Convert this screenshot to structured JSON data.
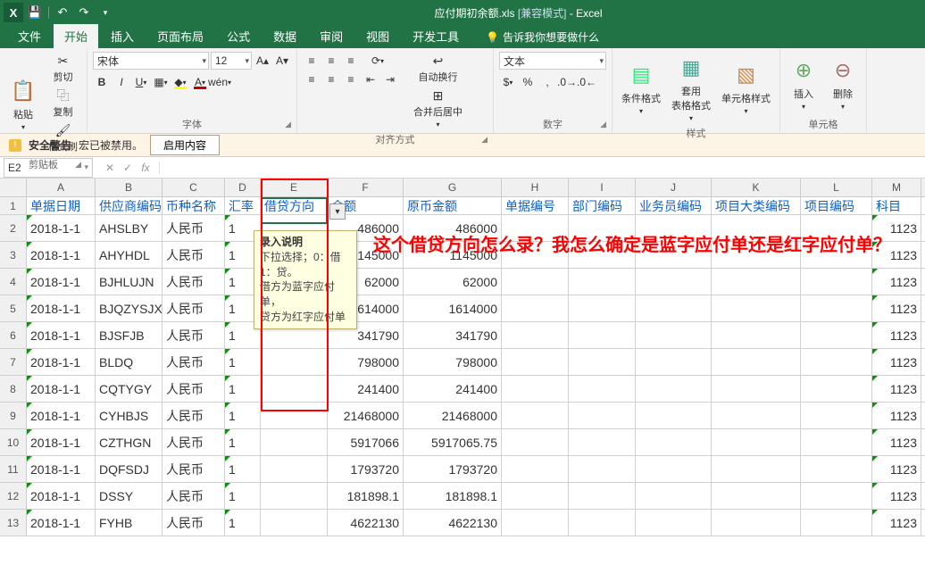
{
  "title": {
    "filename": "应付期初余额.xls",
    "compat": "[兼容模式]",
    "app": "Excel"
  },
  "qat_icons": [
    "save-icon",
    "undo-icon",
    "redo-icon",
    "customize-icon"
  ],
  "tabs": [
    "文件",
    "开始",
    "插入",
    "页面布局",
    "公式",
    "数据",
    "审阅",
    "视图",
    "开发工具"
  ],
  "active_tab": 1,
  "tell_me": "告诉我你想要做什么",
  "ribbon": {
    "clipboard": {
      "label": "剪贴板",
      "paste": "粘贴",
      "cut": "剪切",
      "copy": "复制",
      "painter": "格式刷"
    },
    "font": {
      "label": "字体",
      "name": "宋体",
      "size": "12"
    },
    "align": {
      "label": "对齐方式",
      "wrap": "自动换行",
      "merge": "合并后居中"
    },
    "number": {
      "label": "数字",
      "format": "文本"
    },
    "styles": {
      "label": "样式",
      "cond": "条件格式",
      "table": "套用\n表格格式",
      "cell": "单元格样式"
    },
    "cells": {
      "label": "单元格",
      "insert": "插入",
      "delete": "删除"
    }
  },
  "security": {
    "label": "安全警告",
    "msg": "宏已被禁用。",
    "btn": "启用内容"
  },
  "namebox": "E2",
  "cols": [
    "A",
    "B",
    "C",
    "D",
    "E",
    "F",
    "G",
    "H",
    "I",
    "J",
    "K",
    "L",
    "M"
  ],
  "headers": [
    "单据日期",
    "供应商编码",
    "币种名称",
    "汇率",
    "借贷方向",
    "金额",
    "原币金额",
    "单据编号",
    "部门编码",
    "业务员编码",
    "项目大类编码",
    "项目编码",
    "科目"
  ],
  "rows": [
    {
      "n": 2,
      "A": "2018-1-1",
      "B": "AHSLBY",
      "C": "人民币",
      "D": "1",
      "E": "",
      "F": "486000",
      "G": "486000",
      "M": "1123"
    },
    {
      "n": 3,
      "A": "2018-1-1",
      "B": "AHYHDL",
      "C": "人民币",
      "D": "1",
      "E": "",
      "F": "145000",
      "G": "1145000",
      "M": "1123"
    },
    {
      "n": 4,
      "A": "2018-1-1",
      "B": "BJHLUJN",
      "C": "人民币",
      "D": "1",
      "E": "",
      "F": "62000",
      "G": "62000",
      "M": "1123"
    },
    {
      "n": 5,
      "A": "2018-1-1",
      "B": "BJQZYSJX",
      "C": "人民币",
      "D": "1",
      "E": "",
      "F": "614000",
      "G": "1614000",
      "M": "1123"
    },
    {
      "n": 6,
      "A": "2018-1-1",
      "B": "BJSFJB",
      "C": "人民币",
      "D": "1",
      "E": "",
      "F": "341790",
      "G": "341790",
      "M": "1123"
    },
    {
      "n": 7,
      "A": "2018-1-1",
      "B": "BLDQ",
      "C": "人民币",
      "D": "1",
      "E": "",
      "F": "798000",
      "G": "798000",
      "M": "1123"
    },
    {
      "n": 8,
      "A": "2018-1-1",
      "B": "CQTYGY",
      "C": "人民币",
      "D": "1",
      "E": "",
      "F": "241400",
      "G": "241400",
      "M": "1123"
    },
    {
      "n": 9,
      "A": "2018-1-1",
      "B": "CYHBJS",
      "C": "人民币",
      "D": "1",
      "E": "",
      "F": "21468000",
      "G": "21468000",
      "M": "1123"
    },
    {
      "n": 10,
      "A": "2018-1-1",
      "B": "CZTHGN",
      "C": "人民币",
      "D": "1",
      "E": "",
      "F": "5917066",
      "G": "5917065.75",
      "M": "1123"
    },
    {
      "n": 11,
      "A": "2018-1-1",
      "B": "DQFSDJ",
      "C": "人民币",
      "D": "1",
      "E": "",
      "F": "1793720",
      "G": "1793720",
      "M": "1123"
    },
    {
      "n": 12,
      "A": "2018-1-1",
      "B": "DSSY",
      "C": "人民币",
      "D": "1",
      "E": "",
      "F": "181898.1",
      "G": "181898.1",
      "M": "1123"
    },
    {
      "n": 13,
      "A": "2018-1-1",
      "B": "FYHB",
      "C": "人民币",
      "D": "1",
      "E": "",
      "F": "4622130",
      "G": "4622130",
      "M": "1123"
    }
  ],
  "tooltip": {
    "title": "录入说明",
    "l1": "下拉选择；0：借",
    "l2": "1：贷。",
    "l3": "借方为蓝字应付单，",
    "l4": "贷方为红字应付单"
  },
  "annotation": "这个借贷方向怎么录？我怎么确定是蓝字应付单还是红字应付单？"
}
